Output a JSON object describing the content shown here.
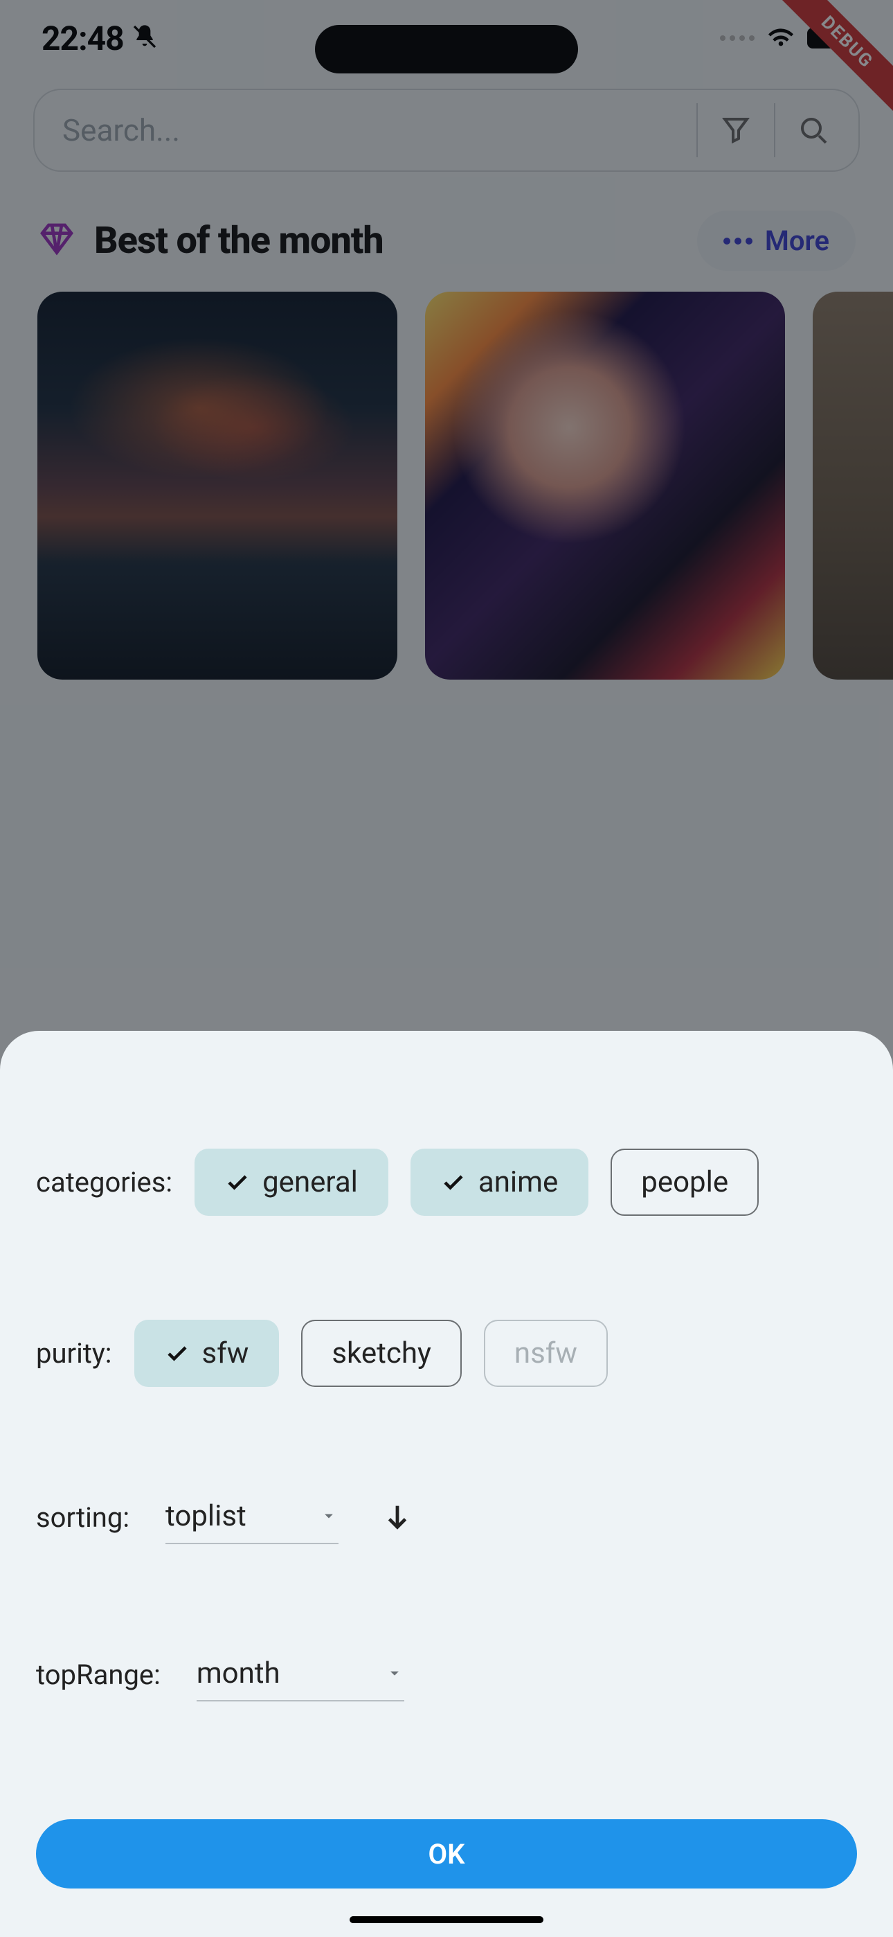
{
  "status": {
    "time": "22:48"
  },
  "debug_banner": "DEBUG",
  "search": {
    "placeholder": "Search..."
  },
  "section": {
    "title": "Best of the month",
    "more": "More"
  },
  "sheet": {
    "labels": {
      "categories": "categories:",
      "purity": "purity:",
      "sorting": "sorting:",
      "topRange": "topRange:"
    },
    "categories": [
      {
        "label": "general",
        "selected": true
      },
      {
        "label": "anime",
        "selected": true
      },
      {
        "label": "people",
        "selected": false
      }
    ],
    "purity": [
      {
        "label": "sfw",
        "selected": true,
        "disabled": false
      },
      {
        "label": "sketchy",
        "selected": false,
        "disabled": false
      },
      {
        "label": "nsfw",
        "selected": false,
        "disabled": true
      }
    ],
    "sorting": {
      "value": "toplist",
      "direction": "desc"
    },
    "topRange": {
      "value": "month"
    },
    "ok": "OK"
  }
}
